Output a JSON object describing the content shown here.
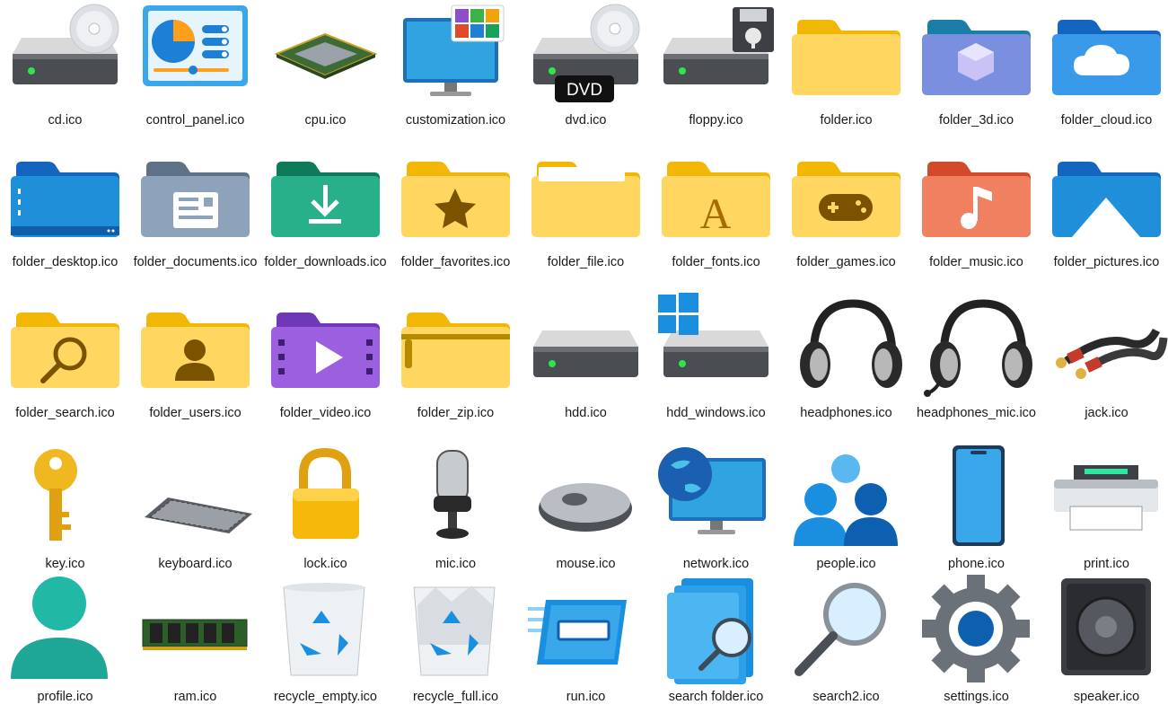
{
  "window": {
    "view": "Large icons",
    "background": "#ffffff"
  },
  "files": [
    {
      "name": "cd.ico",
      "icon": "cd-drive-icon"
    },
    {
      "name": "control_panel.ico",
      "icon": "control-panel-icon"
    },
    {
      "name": "cpu.ico",
      "icon": "cpu-icon"
    },
    {
      "name": "customization.ico",
      "icon": "customization-icon"
    },
    {
      "name": "dvd.ico",
      "icon": "dvd-drive-icon",
      "badge": "DVD"
    },
    {
      "name": "floppy.ico",
      "icon": "floppy-drive-icon"
    },
    {
      "name": "folder.ico",
      "icon": "folder-icon"
    },
    {
      "name": "folder_3d.ico",
      "icon": "folder-3d-icon"
    },
    {
      "name": "folder_cloud.ico",
      "icon": "folder-cloud-icon"
    },
    {
      "name": "folder_desktop.ico",
      "icon": "folder-desktop-icon"
    },
    {
      "name": "folder_documents.ico",
      "icon": "folder-documents-icon"
    },
    {
      "name": "folder_downloads.ico",
      "icon": "folder-downloads-icon"
    },
    {
      "name": "folder_favorites.ico",
      "icon": "folder-favorites-icon"
    },
    {
      "name": "folder_file.ico",
      "icon": "folder-file-icon"
    },
    {
      "name": "folder_fonts.ico",
      "icon": "folder-fonts-icon",
      "glyph": "A"
    },
    {
      "name": "folder_games.ico",
      "icon": "folder-games-icon"
    },
    {
      "name": "folder_music.ico",
      "icon": "folder-music-icon"
    },
    {
      "name": "folder_pictures.ico",
      "icon": "folder-pictures-icon"
    },
    {
      "name": "folder_search.ico",
      "icon": "folder-search-icon"
    },
    {
      "name": "folder_users.ico",
      "icon": "folder-users-icon"
    },
    {
      "name": "folder_video.ico",
      "icon": "folder-video-icon"
    },
    {
      "name": "folder_zip.ico",
      "icon": "folder-zip-icon"
    },
    {
      "name": "hdd.ico",
      "icon": "hdd-icon"
    },
    {
      "name": "hdd_windows.ico",
      "icon": "hdd-windows-icon"
    },
    {
      "name": "headphones.ico",
      "icon": "headphones-icon"
    },
    {
      "name": "headphones_mic.ico",
      "icon": "headphones-mic-icon"
    },
    {
      "name": "jack.ico",
      "icon": "jack-cable-icon"
    },
    {
      "name": "key.ico",
      "icon": "key-icon"
    },
    {
      "name": "keyboard.ico",
      "icon": "keyboard-icon"
    },
    {
      "name": "lock.ico",
      "icon": "lock-icon"
    },
    {
      "name": "mic.ico",
      "icon": "microphone-icon"
    },
    {
      "name": "mouse.ico",
      "icon": "mouse-icon"
    },
    {
      "name": "network.ico",
      "icon": "network-icon"
    },
    {
      "name": "people.ico",
      "icon": "people-icon"
    },
    {
      "name": "phone.ico",
      "icon": "phone-icon"
    },
    {
      "name": "print.ico",
      "icon": "printer-icon"
    },
    {
      "name": "profile.ico",
      "icon": "profile-icon"
    },
    {
      "name": "ram.ico",
      "icon": "ram-icon"
    },
    {
      "name": "recycle_empty.ico",
      "icon": "recycle-bin-empty-icon"
    },
    {
      "name": "recycle_full.ico",
      "icon": "recycle-bin-full-icon"
    },
    {
      "name": "run.ico",
      "icon": "run-icon"
    },
    {
      "name": "search folder.ico",
      "icon": "search-folder-icon"
    },
    {
      "name": "search2.ico",
      "icon": "magnifier-icon"
    },
    {
      "name": "settings.ico",
      "icon": "settings-gear-icon"
    },
    {
      "name": "speaker.ico",
      "icon": "speaker-icon"
    }
  ]
}
